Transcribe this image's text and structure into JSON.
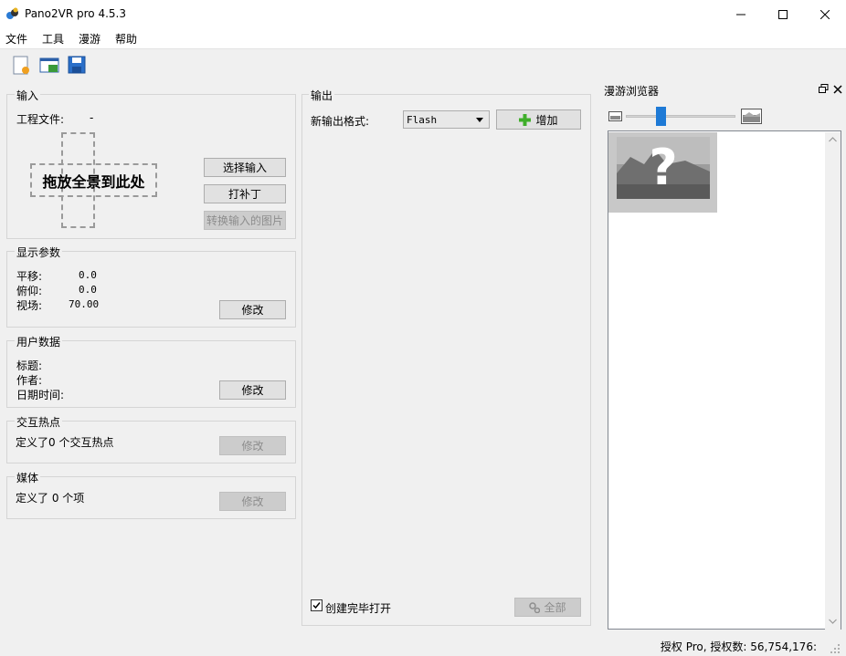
{
  "window": {
    "title": "Pano2VR pro 4.5.3",
    "minimize_glyph": "—",
    "maximize_glyph": "☐",
    "close_glyph": "✕"
  },
  "menu": [
    "文件",
    "工具",
    "漫游",
    "帮助"
  ],
  "toolbar": {
    "icons": [
      "new-project-icon",
      "open-project-icon",
      "save-icon"
    ]
  },
  "input_group": {
    "title": "输入",
    "project_file_label": "工程文件:",
    "project_file_value": "-",
    "drop_text": "拖放全景到此处",
    "select_input": "选择输入",
    "patch": "打补丁",
    "convert_images": "转换输入的图片"
  },
  "display_params": {
    "title": "显示参数",
    "pan_label": "平移:",
    "pan_value": "0.0",
    "tilt_label": "俯仰:",
    "tilt_value": "0.0",
    "fov_label": "视场:",
    "fov_value": "70.00",
    "modify": "修改"
  },
  "user_data": {
    "title": "用户数据",
    "title_label": "标题:",
    "author_label": "作者:",
    "datetime_label": "日期时间:",
    "modify": "修改"
  },
  "hotspots": {
    "title": "交互热点",
    "summary": "定义了0 个交互热点",
    "modify": "修改"
  },
  "media": {
    "title": "媒体",
    "summary": "定义了 0 个项",
    "modify": "修改"
  },
  "output": {
    "title": "输出",
    "format_label": "新输出格式:",
    "format_value": "Flash",
    "add": "增加",
    "open_after_create": "创建完毕打开",
    "all": "全部"
  },
  "browser": {
    "title": "漫游浏览器",
    "restore_glyph": "🗗",
    "close_glyph": "✕",
    "zoom_level": 0.3,
    "thumbnail_glyph": "?"
  },
  "status": {
    "license": "授权 Pro, 授权数: 56,754,176:"
  },
  "colors": {
    "accent": "#1e7ad6",
    "green_plus": "#3fae2a"
  }
}
